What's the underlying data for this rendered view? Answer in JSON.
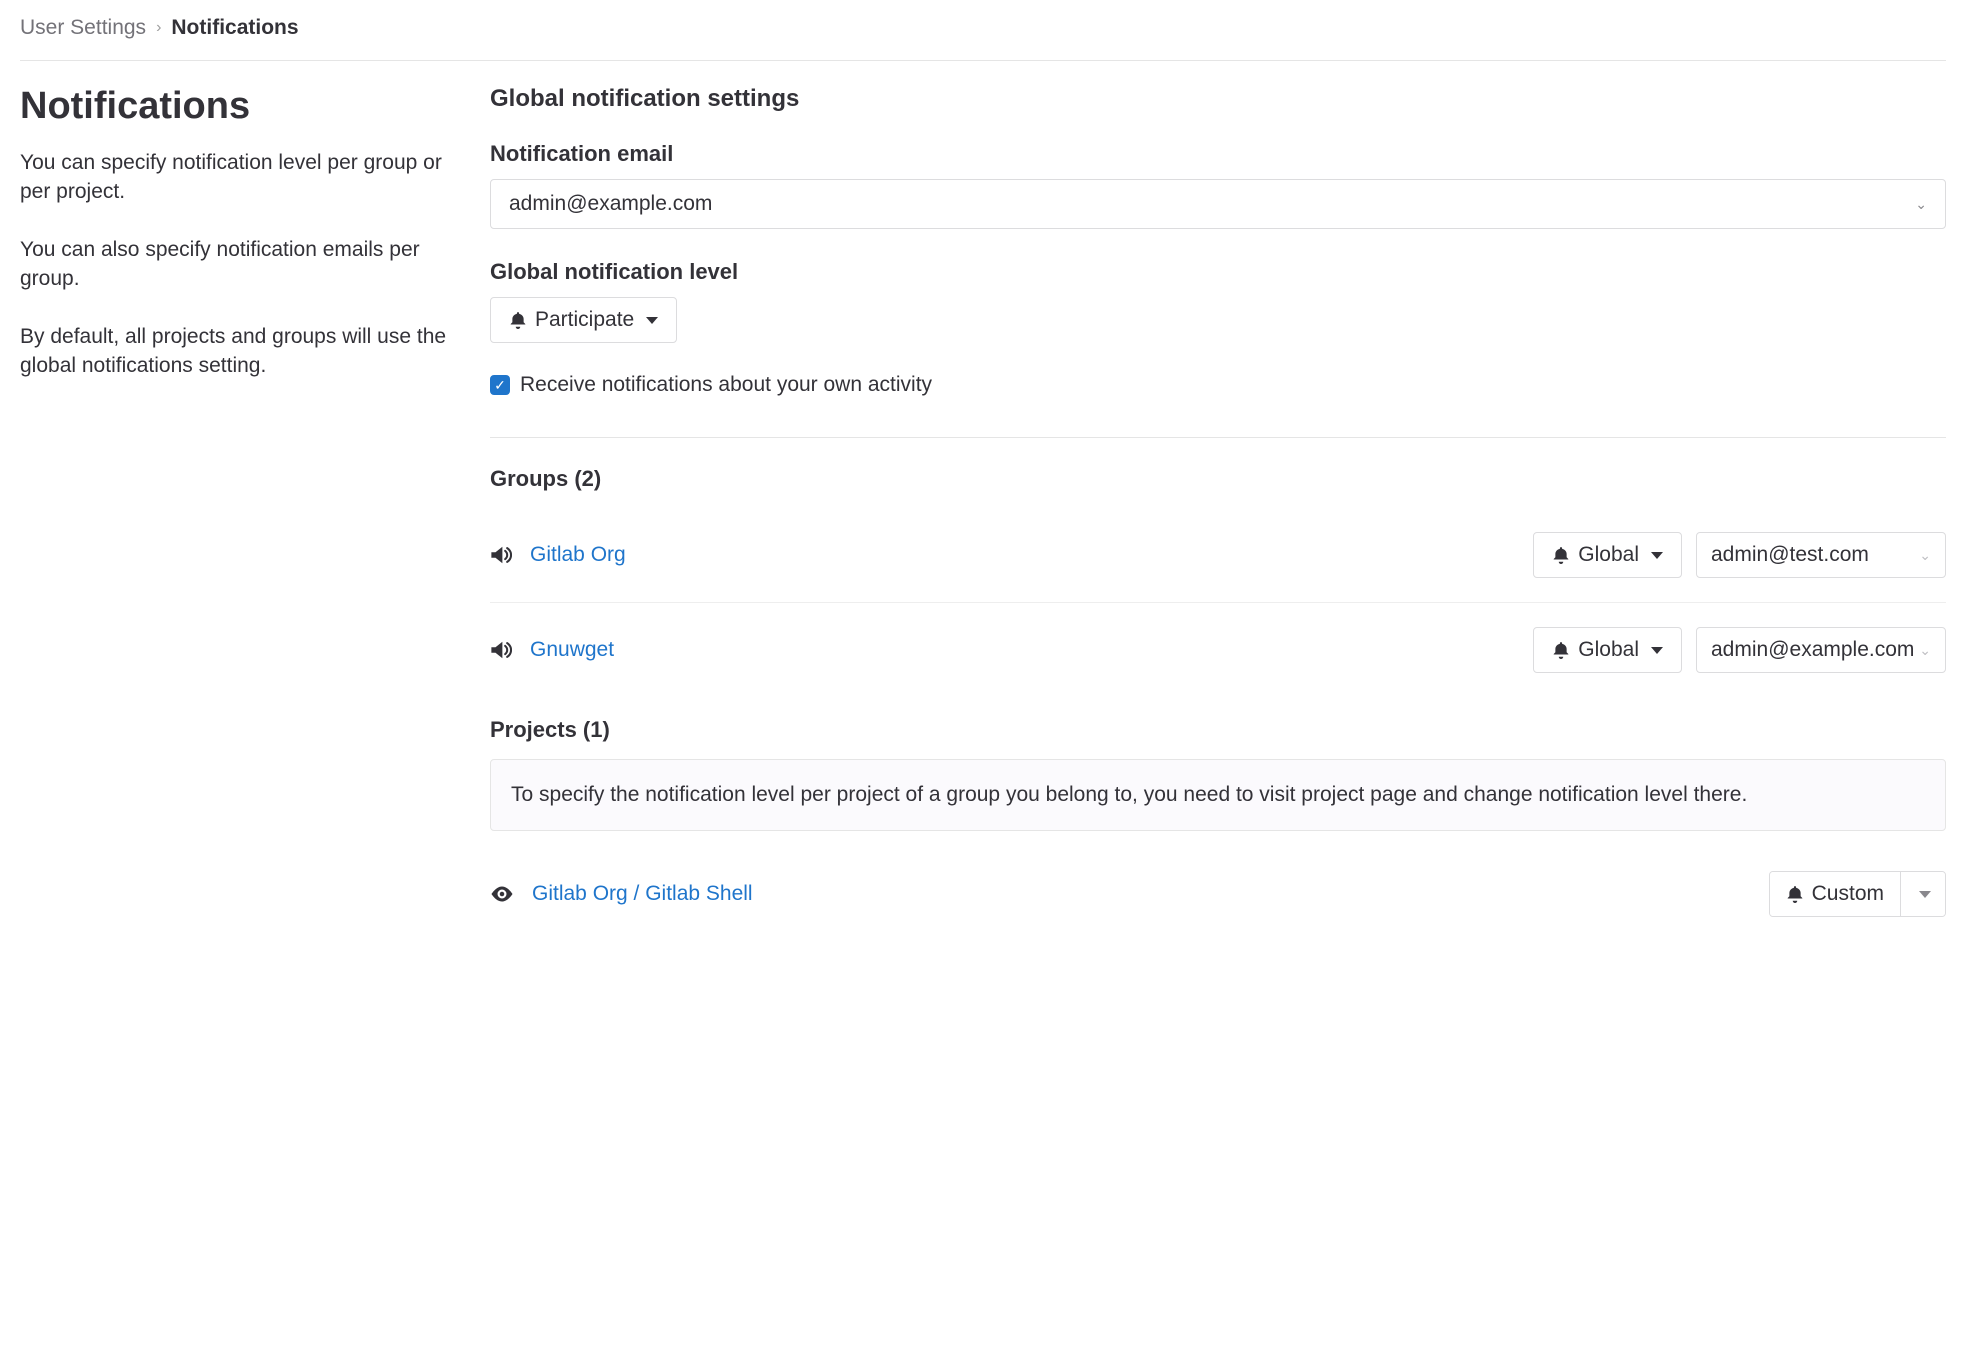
{
  "breadcrumb": {
    "parent": "User Settings",
    "current": "Notifications"
  },
  "left": {
    "heading": "Notifications",
    "p1": "You can specify notification level per group or per project.",
    "p2": "You can also specify notification emails per group.",
    "p3": "By default, all projects and groups will use the global notifications setting."
  },
  "global": {
    "section_title": "Global notification settings",
    "email_label": "Notification email",
    "email_value": "admin@example.com",
    "level_label": "Global notification level",
    "level_value": "Participate",
    "own_activity_label": "Receive notifications about your own activity",
    "own_activity_checked": true
  },
  "groups": {
    "title": "Groups (2)",
    "items": [
      {
        "name": "Gitlab Org",
        "level": "Global",
        "email": "admin@test.com"
      },
      {
        "name": "Gnuwget",
        "level": "Global",
        "email": "admin@example.com"
      }
    ]
  },
  "projects": {
    "title": "Projects (1)",
    "info": "To specify the notification level per project of a group you belong to, you need to visit project page and change notification level there.",
    "items": [
      {
        "name": "Gitlab Org / Gitlab Shell",
        "level": "Custom"
      }
    ]
  }
}
